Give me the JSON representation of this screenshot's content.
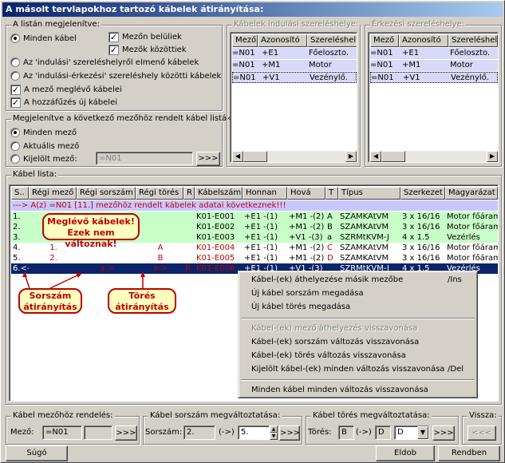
{
  "window": {
    "title": "A másolt tervlapokhoz tartozó kábelek átirányítása:",
    "close": "✕"
  },
  "listing": {
    "group_label": "A listán megjelenítve:",
    "all_cables": "Minden kábel",
    "inside_field": "Mezőn belüliek",
    "between_fields": "Mezők közöttiek",
    "from_start_loc": "Az 'indulási' szereléshelyről elmenő kábelek",
    "between_start_end": "Az 'indulási-érkezési' szereléshely közötti kábelek",
    "existing_field_cables": "A mező meglévő kábelei",
    "new_attach_cables": "A hozzáfűzés új kábelei"
  },
  "assign": {
    "group_label": "Megjelenítve a következő mezőhöz rendelt kábel listák:",
    "all_fields": "Minden mező",
    "current_field": "Aktuális mező",
    "selected_field": "Kijelölt mező:",
    "selected_value": "=N01",
    "go": ">>>"
  },
  "start_loc": {
    "group_label": "Kábelek indulási szereléshelye:",
    "headers": [
      "Mező",
      "Azonosító",
      "Szereléshely"
    ],
    "rows": [
      [
        "=N01",
        "+E1",
        "Főeloszto."
      ],
      [
        "=N01",
        "+M1",
        "Motor"
      ],
      [
        "=N01",
        "+V1",
        "Vezénylő."
      ]
    ]
  },
  "end_loc": {
    "group_label": "Érkezési szereléshelye:",
    "headers": [
      "Mező",
      "Azonosító",
      "Szereléshely"
    ],
    "rows": [
      [
        "=N01",
        "+E1",
        "Főeloszto."
      ],
      [
        "=N01",
        "+M1",
        "Motor"
      ],
      [
        "=N01",
        "+V1",
        "Vezénylő."
      ]
    ]
  },
  "cables": {
    "group_label": "Kábel lista:",
    "headers": [
      "S..",
      "Régi mező",
      "Régi sorszám",
      "Régi törés",
      "R",
      "Kábelszám",
      "Honnan",
      "Hová",
      "T",
      "Típus",
      "Szerkezet",
      "Magyarázat"
    ],
    "info": "---> A(z) =N01 [11.] mezőhöz rendelt kábelek adatai következnek!!!",
    "rows": [
      [
        "1.",
        "",
        "",
        "",
        "",
        "K01-E001",
        "+E1 -(1)",
        "+M1 -(2)",
        "A",
        "SZAMKAtVM",
        "3 x 16/16",
        "Motor főáramk"
      ],
      [
        "2.",
        "",
        "",
        "",
        "",
        "K01-E002",
        "+E1 -(1)",
        "+M1 -(2)",
        "B",
        "SZAMKAtVM",
        "3 x 16/16",
        "Motor főáramk"
      ],
      [
        "3.",
        "",
        "",
        "",
        "",
        "K01-E003",
        "+E1 -(1)",
        "+V1 -(3)",
        "a",
        "SZRMtKVM-J",
        "4 x 1.5",
        "Vezérlés"
      ],
      [
        "4.",
        "1.",
        "",
        "A",
        "",
        "K01-E004",
        "+E1 -(1)",
        "+M1 -(2)",
        "C",
        "SZAMKAtVM",
        "3 x 16/16",
        "Motor főáramk"
      ],
      [
        "5.",
        "2.",
        "",
        "B",
        "",
        "K01-E005",
        "+E1 -(1)",
        "+M1 -(2)",
        "D",
        "SZAMKAtVM",
        "3 x 16/16",
        "Motor főáramk"
      ],
      [
        "6.<-",
        "",
        "a->",
        "a->",
        "R",
        "K01-E006",
        "+E1 -(1)",
        "+V1 -(3)",
        "",
        "SZRMtKVM-J",
        "4 x 1.5",
        "Vezérlés"
      ]
    ]
  },
  "callouts": {
    "existing": "Meglévő kábelek! Ezek nem változnak!",
    "serial": "Sorszám átirányítás",
    "break": "Törés átirányítás"
  },
  "context_menu": {
    "items": [
      {
        "label": "Kábel-(ek) áthelyezése másik mezőbe",
        "shortcut": "/Ins",
        "enabled": true
      },
      {
        "label": "Új kábel sorszám megadása",
        "shortcut": "",
        "enabled": true
      },
      {
        "label": "Új kábel törés megadása",
        "shortcut": "",
        "enabled": true
      },
      {
        "label": "Kábel-(ek) mező áthelyezés visszavonása",
        "shortcut": "",
        "enabled": false
      },
      {
        "label": "Kábel-(ek) sorszám változás visszavonása",
        "shortcut": "",
        "enabled": true
      },
      {
        "label": "Kábel-(ek) törés változás visszavonása",
        "shortcut": "",
        "enabled": true
      },
      {
        "label": "Kijelölt kábel-(ek) minden változás visszavonása",
        "shortcut": "/Del",
        "enabled": true
      },
      {
        "label": "Minden kábel minden változás visszavonása",
        "shortcut": "",
        "enabled": true
      }
    ]
  },
  "bottom": {
    "field_assign_label": "Kábel mezőhöz rendelés:",
    "field_label": "Mező:",
    "field_value": "=N01",
    "field_extra": "",
    "go": ">>>",
    "serial_label": "Kábel sorszám megváltoztatása:",
    "serial_field_label": "Sorszám:",
    "serial_old": "2.",
    "arrow": "(->)",
    "serial_new": "5.",
    "break_label": "Kábel törés megváltoztatása:",
    "break_field_label": "Törés:",
    "break_old": "B",
    "break_new": "D",
    "back_label": "Vissza:",
    "back_btn": "<<<"
  },
  "buttons": {
    "help": "Súgó",
    "discard": "Eldob",
    "ok": "Rendben"
  },
  "colors": {
    "green_row": "#c8ffc8",
    "white_row": "#ffffff",
    "selected_row": "#0a246a",
    "info_row": "#c8c8ff",
    "red": "#c00000"
  }
}
